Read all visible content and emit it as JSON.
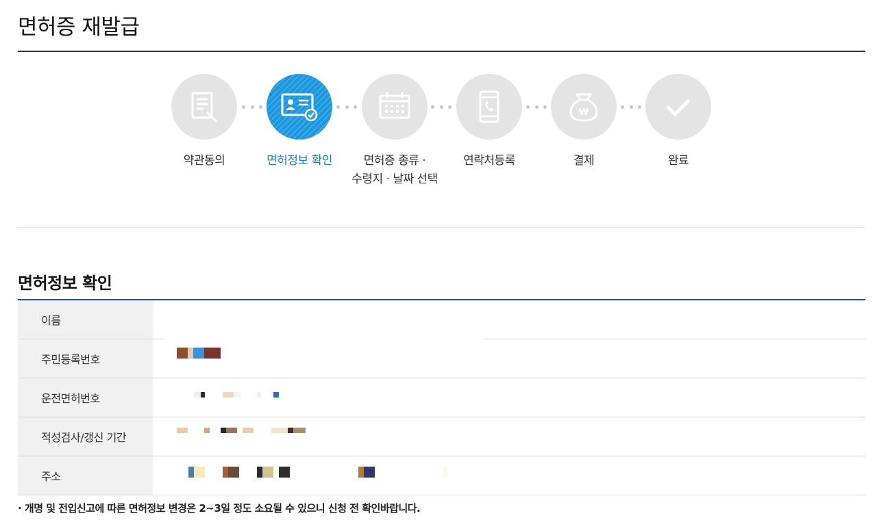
{
  "page": {
    "title": "면허증 재발급"
  },
  "steps": [
    {
      "label": "약관동의",
      "icon": "document-pen-icon",
      "active": false
    },
    {
      "label": "면허정보 확인",
      "icon": "id-card-check-icon",
      "active": true
    },
    {
      "label": "면허증 종류 ·",
      "label2": "수령지 · 날짜 선택",
      "icon": "calendar-icon",
      "active": false
    },
    {
      "label": "연락처등록",
      "icon": "mobile-phone-icon",
      "active": false
    },
    {
      "label": "결제",
      "icon": "money-bag-won-icon",
      "active": false
    },
    {
      "label": "완료",
      "icon": "checkmark-icon",
      "active": false
    }
  ],
  "section": {
    "title": "면허정보 확인",
    "fields": [
      {
        "label": "이름"
      },
      {
        "label": "주민등록번호"
      },
      {
        "label": "운전면허번호"
      },
      {
        "label": "적성검사/갱신 기간"
      },
      {
        "label": "주소"
      }
    ]
  },
  "notice": "· 개명 및 전입신고에 따른 면허정보 변경은 2~3일 정도 소요될 수 있으니 신청 전 확인바랍니다.",
  "colors": {
    "accent": "#1b7fd6",
    "table_border": "#1a56a6",
    "step_inactive": "#e4e4e4"
  }
}
